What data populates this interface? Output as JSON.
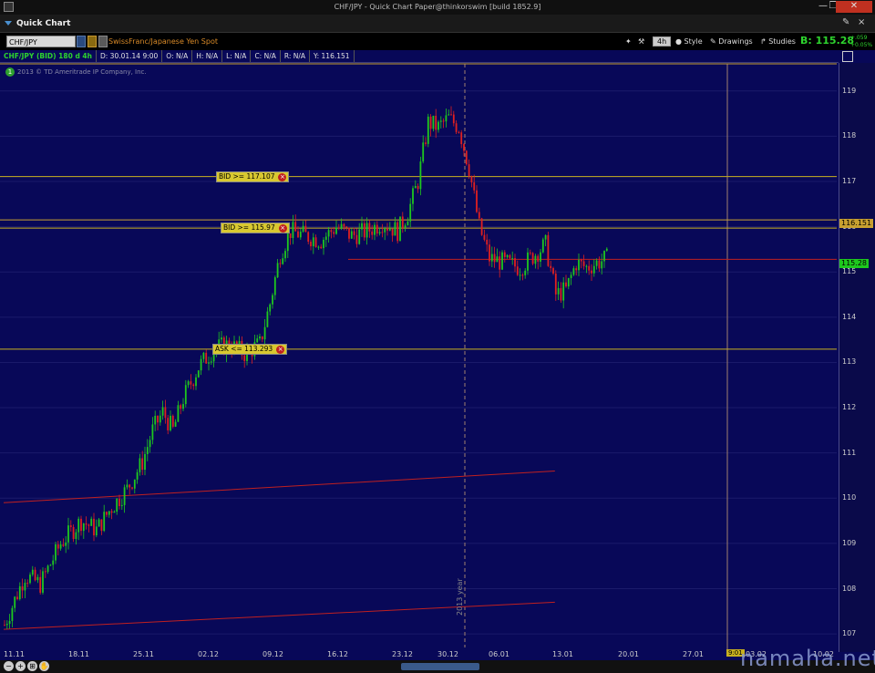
{
  "window": {
    "title": "CHF/JPY - Quick Chart Paper@thinkorswim [build 1852.9]"
  },
  "panel": {
    "title": "Quick Chart"
  },
  "toolbar": {
    "symbol": "CHF/JPY",
    "description": "SwissFranc/Japanese Yen Spot",
    "timeframe": "4h",
    "style_label": "Style",
    "drawings_label": "Drawings",
    "studies_label": "Studies",
    "bid_price": "B: 115.28",
    "change1": "+.059",
    "change2": "+0.05%"
  },
  "infobar": {
    "symbol": "CHF/JPY (BID) 180 d 4h",
    "date": "D: 30.01.14 9:00",
    "open": "O: N/A",
    "high": "H: N/A",
    "low": "L: N/A",
    "close": "C: N/A",
    "range": "R: N/A",
    "y": "Y: 116.151"
  },
  "copyright": "2013 © TD Ameritrade IP Company, Inc.",
  "alerts": [
    {
      "label": "BID >= 117.107",
      "price": 117.107
    },
    {
      "label": "BID >= 115.97",
      "price": 115.97
    },
    {
      "label": "ASK <= 113.293",
      "price": 113.293
    }
  ],
  "price_tags": {
    "crosshair": "116.151",
    "last": "115.28"
  },
  "vertical_label": "2013 year",
  "time_badge": "9:01",
  "watermark": "namaha.net",
  "colors": {
    "up": "#1ec81e",
    "down": "#e02020",
    "bg": "#080858",
    "alert_line": "#c8b020",
    "trend": "#c02020"
  },
  "chart_data": {
    "type": "candlestick",
    "title": "",
    "ylim": [
      106.7,
      119.6
    ],
    "y_ticks": [
      "119",
      "118",
      "117",
      "116",
      "115",
      "114",
      "113",
      "112",
      "111",
      "110",
      "109",
      "108",
      "107"
    ],
    "x_ticks": [
      "11.11",
      "18.11",
      "25.11",
      "02.12",
      "09.12",
      "16.12",
      "23.12",
      "30.12",
      "06.01",
      "13.01",
      "20.01",
      "27.01",
      "03.02",
      "10.02"
    ],
    "price_path": [
      [
        0,
        107.2
      ],
      [
        8,
        108.3
      ],
      [
        14,
        108.1
      ],
      [
        22,
        109.0
      ],
      [
        30,
        109.5
      ],
      [
        36,
        109.3
      ],
      [
        42,
        109.8
      ],
      [
        48,
        110.2
      ],
      [
        54,
        110.8
      ],
      [
        58,
        111.5
      ],
      [
        62,
        111.9
      ],
      [
        66,
        111.5
      ],
      [
        70,
        112.2
      ],
      [
        76,
        112.9
      ],
      [
        82,
        113.3
      ],
      [
        88,
        113.4
      ],
      [
        94,
        113.2
      ],
      [
        100,
        113.4
      ],
      [
        104,
        114.3
      ],
      [
        108,
        115.4
      ],
      [
        112,
        115.9
      ],
      [
        118,
        115.8
      ],
      [
        124,
        115.7
      ],
      [
        130,
        116.0
      ],
      [
        136,
        115.8
      ],
      [
        142,
        115.9
      ],
      [
        148,
        116.1
      ],
      [
        154,
        115.9
      ],
      [
        158,
        116.3
      ],
      [
        162,
        117.0
      ],
      [
        166,
        118.3
      ],
      [
        170,
        118.2
      ],
      [
        174,
        118.4
      ],
      [
        178,
        118.2
      ],
      [
        182,
        117.3
      ],
      [
        186,
        116.0
      ],
      [
        190,
        115.3
      ],
      [
        196,
        115.2
      ],
      [
        202,
        115.1
      ],
      [
        208,
        115.4
      ],
      [
        212,
        115.6
      ],
      [
        216,
        114.5
      ],
      [
        220,
        114.6
      ],
      [
        224,
        115.2
      ],
      [
        228,
        115.1
      ],
      [
        232,
        115.2
      ],
      [
        236,
        115.3
      ]
    ],
    "trend_lines": [
      {
        "from": [
          0,
          109.9
        ],
        "to": [
          216,
          110.6
        ]
      },
      {
        "from": [
          0,
          107.1
        ],
        "to": [
          216,
          107.7
        ]
      }
    ]
  }
}
